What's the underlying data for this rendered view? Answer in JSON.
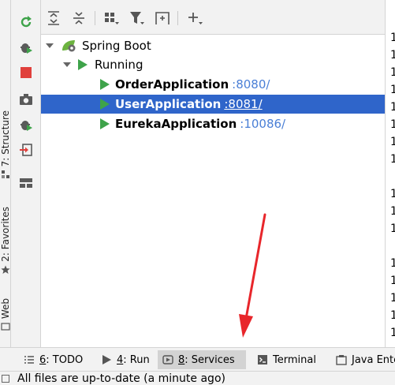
{
  "left_stripe": {
    "tabs": [
      {
        "num": "7",
        "label": ": Structure",
        "icon": "structure-icon"
      },
      {
        "num": "2",
        "label": ": Favorites",
        "icon": "star-icon"
      },
      {
        "num": "",
        "label": "Web",
        "icon": "web-icon"
      }
    ]
  },
  "actions": [
    {
      "icon": "rerun-icon"
    },
    {
      "icon": "debug-icon"
    },
    {
      "icon": "stop-icon"
    },
    {
      "icon": "snapshot-icon"
    },
    {
      "icon": "run-with-coverage-icon"
    },
    {
      "icon": "attach-icon"
    },
    {
      "icon": "layout-icon"
    }
  ],
  "toolbar": {
    "buttons": [
      {
        "icon": "expand-all-icon"
      },
      {
        "icon": "collapse-all-icon"
      },
      {
        "icon": "group-by-icon"
      },
      {
        "icon": "filter-icon"
      },
      {
        "icon": "new-tab-icon"
      },
      {
        "icon": "add-service-icon"
      }
    ]
  },
  "tree": {
    "root": {
      "label": "Spring Boot"
    },
    "group": {
      "label": "Running"
    },
    "apps": [
      {
        "name": "OrderApplication",
        "port": ":8080/",
        "selected": false
      },
      {
        "name": "UserApplication",
        "port": ":8081/",
        "selected": true
      },
      {
        "name": "EurekaApplication",
        "port": ":10086/",
        "selected": false
      }
    ]
  },
  "console_gutter": {
    "lines": [
      "1",
      "1",
      "1",
      "1",
      "1",
      "1",
      "1",
      "1",
      "1",
      "1",
      "1",
      "1",
      "1",
      "1",
      "1",
      "1"
    ]
  },
  "bottom_tabs": [
    {
      "num": "6",
      "label": ": TODO",
      "icon": "todo-icon",
      "active": false
    },
    {
      "num": "4",
      "label": ": Run",
      "icon": "run-icon",
      "active": false
    },
    {
      "num": "8",
      "label": ": Services",
      "icon": "services-icon",
      "active": true
    },
    {
      "num": "",
      "label": "Terminal",
      "icon": "terminal-icon",
      "active": false
    },
    {
      "num": "",
      "label": "Java Ente",
      "icon": "java-enterprise-icon",
      "active": false
    }
  ],
  "status": {
    "message": "All files are up-to-date (a minute ago)"
  },
  "colors": {
    "selection": "#2f65ca",
    "run_green": "#3ea34a",
    "port_link": "#4a7fd6",
    "annotation_red": "#e8262b"
  }
}
